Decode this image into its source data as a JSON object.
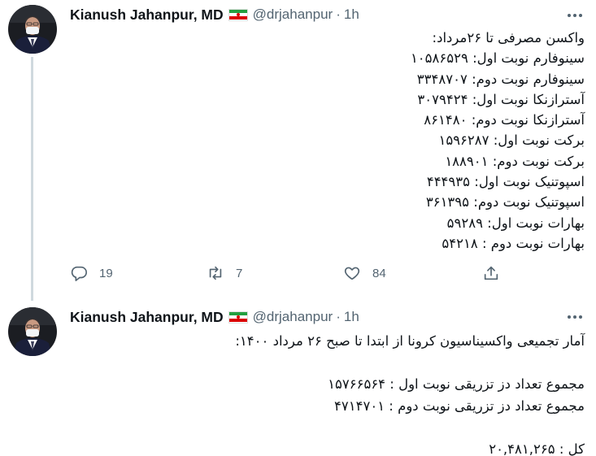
{
  "tweets": [
    {
      "author": {
        "display_name": "Kianush Jahanpur, MD",
        "handle": "@drjahanpur",
        "time": "1h",
        "flag_icon": "iran-flag-icon"
      },
      "lines": [
        "واکسن مصرفی تا ۲۶مرداد:",
        "سینوفارم نوبت اول: ۱۰۵۸۶۵۲۹",
        "سینوفارم نوبت دوم: ۳۳۴۸۷۰۷",
        "آسترازنکا نوبت اول: ۳۰۷۹۴۲۴",
        "آسترازنکا نوبت دوم: ۸۶۱۴۸۰",
        "برکت نوبت اول: ۱۵۹۶۲۸۷",
        "برکت نوبت دوم: ۱۸۸۹۰۱",
        "اسپوتنیک نوبت اول: ۴۴۴۹۳۵",
        "اسپوتنیک نوبت دوم: ۳۶۱۳۹۵",
        "بهارات نوبت اول: ۵۹۲۸۹",
        "بهارات نوبت دوم : ۵۴۲۱۸"
      ],
      "actions": {
        "replies": "19",
        "retweets": "7",
        "likes": "84"
      }
    },
    {
      "author": {
        "display_name": "Kianush Jahanpur, MD",
        "handle": "@drjahanpur",
        "time": "1h",
        "flag_icon": "iran-flag-icon"
      },
      "lines": [
        "آمار تجمیعی واکسیناسیون کرونا از ابتدا تا صبح ۲۶ مرداد ۱۴۰۰:",
        "",
        "مجموع تعداد دز تزریقی نوبت اول : ۱۵۷۶۶۵۶۴",
        "مجموع تعداد دز تزریقی نوبت دوم : ۴۷۱۴۷۰۱",
        "",
        "کل :  ۲۰,۴۸۱,۲۶۵"
      ]
    }
  ],
  "colors": {
    "text": "#0f1419",
    "secondary": "#536471",
    "thread_line": "#cfd9de"
  }
}
